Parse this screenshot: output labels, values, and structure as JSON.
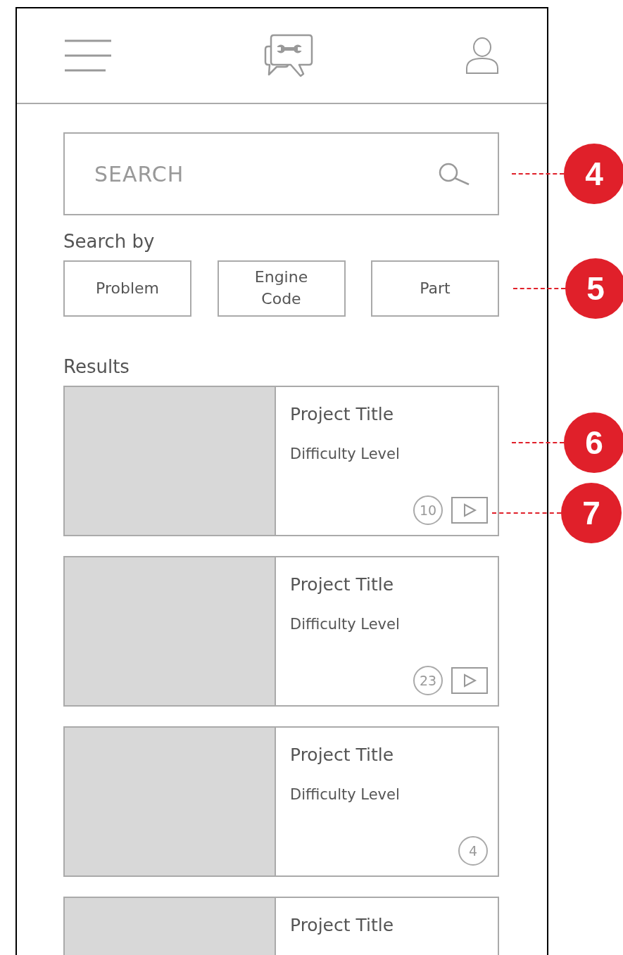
{
  "search": {
    "placeholder": "SEARCH",
    "callout": "4"
  },
  "search_by": {
    "label": "Search by",
    "options": [
      "Problem",
      "Engine Code",
      "Part"
    ],
    "callout": "5"
  },
  "results": {
    "label": "Results",
    "cards": [
      {
        "title": "Project Title",
        "difficulty": "Difficulty Level",
        "count": "10",
        "video": true,
        "callout": "6",
        "video_callout": "7"
      },
      {
        "title": "Project Title",
        "difficulty": "Difficulty Level",
        "count": "23",
        "video": true
      },
      {
        "title": "Project Title",
        "difficulty": "Difficulty Level",
        "count": "4",
        "video": false
      },
      {
        "title": "Project Title"
      }
    ]
  }
}
